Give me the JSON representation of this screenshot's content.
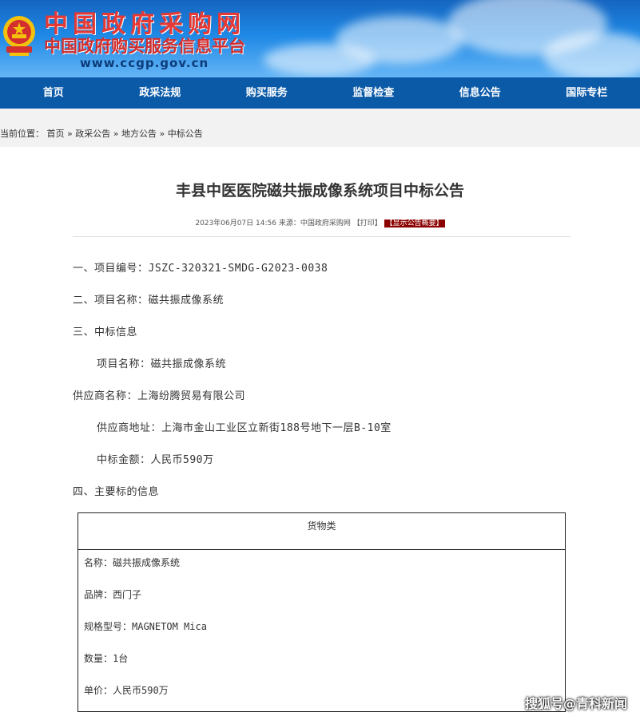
{
  "header": {
    "logo_title": "中国政府采购网",
    "logo_subtitle": "中国政府购买服务信息平台",
    "logo_url": "www.ccgp.gov.cn"
  },
  "nav": {
    "items": [
      "首页",
      "政采法规",
      "购买服务",
      "监督检查",
      "信息公告",
      "国际专栏"
    ]
  },
  "breadcrumb": {
    "prefix": "当前位置：",
    "items": [
      "首页",
      "政采公告",
      "地方公告",
      "中标公告"
    ],
    "separator": " » "
  },
  "article": {
    "title": "丰县中医医院磁共振成像系统项目中标公告",
    "date": "2023年06月07日 14:56",
    "source_label": "来源：",
    "source": "中国政府采购网",
    "print": "【打印】",
    "summary_tag": "【显示公告概要】",
    "lines": [
      "一、项目编号：JSZC-320321-SMDG-G2023-0038",
      "二、项目名称：磁共振成像系统",
      "三、中标信息",
      "项目名称：磁共振成像系统",
      "供应商名称：上海纷腾贸易有限公司",
      "供应商地址：上海市金山工业区立新街188号地下一层B-10室",
      "中标金额：人民币590万",
      "四、主要标的信息"
    ]
  },
  "table": {
    "header": "货物类",
    "rows": [
      "名称：磁共振成像系统",
      "品牌：西门子",
      "规格型号：MAGNETOM Mica",
      "数量：1台",
      "单价：人民币590万"
    ]
  },
  "watermark": "搜狐号@青科新闻",
  "colors": {
    "nav_bg": "#0b5aa8",
    "logo_red": "#e53935",
    "summary_tag_bg": "#8b0000"
  }
}
